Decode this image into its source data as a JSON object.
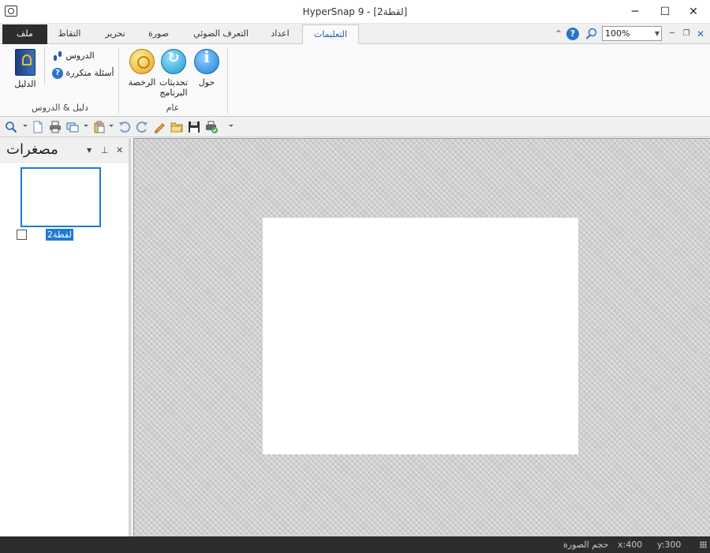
{
  "window": {
    "title": "HyperSnap 9 - [لقطة2]",
    "minimize_glyph": "─",
    "maximize_glyph": "☐",
    "close_glyph": "✕"
  },
  "menu": {
    "file_tab": "ملف",
    "tabs": [
      {
        "label": "التقاط",
        "active": false
      },
      {
        "label": "تحرير",
        "active": false
      },
      {
        "label": "صورة",
        "active": false
      },
      {
        "label": "التعرف الضوئي",
        "active": false
      },
      {
        "label": "اعداد",
        "active": false
      },
      {
        "label": "التعليمات",
        "active": true
      }
    ],
    "zoom_value": "100%",
    "collapse_glyph": "⌃"
  },
  "ribbon": {
    "general_group": {
      "caption": "عام",
      "about": "حول",
      "updates_line1": "تحديثات",
      "updates_line2": "البرنامج",
      "license": "الرخصة"
    },
    "guide_group": {
      "caption": "دليل & الدروس",
      "guide": "الدليل",
      "tutorials": "الدروس",
      "faq": "أسئلة متكررة"
    }
  },
  "thumbnails": {
    "title": "مصغرات",
    "item_label": "لقطة2"
  },
  "statusbar": {
    "image_size_label": "حجم الصورة",
    "x": "x:400",
    "y": "y:300"
  },
  "colors": {
    "accent": "#1e7ad6",
    "dark_chrome": "#2d2d30",
    "active_tab_text": "#1f5fa8"
  },
  "icons": [
    "app-camera-icon",
    "help-icon",
    "zoom-icon",
    "info-icon",
    "update-icon",
    "license-award-icon",
    "book-icon",
    "footsteps-icon",
    "faq-icon",
    "magnifier-icon",
    "new-icon",
    "print-icon",
    "copy-window-icon",
    "paste-icon",
    "undo-icon",
    "redo-icon",
    "pencil-icon",
    "open-folder-icon",
    "save-icon",
    "printer-check-icon"
  ]
}
